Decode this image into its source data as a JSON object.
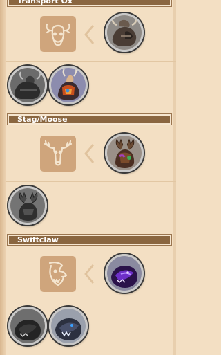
{
  "sections": [
    {
      "title": "Transport Ox",
      "type_icon": "ox-head-icon",
      "evolved_token": "transport-ox-mount-icon",
      "tokens": [
        "transport-ox-dark-token-icon",
        "transport-ox-red-token-icon"
      ]
    },
    {
      "title": "Stag/Moose",
      "type_icon": "moose-head-icon",
      "evolved_token": "stag-moose-mount-icon",
      "tokens": [
        "stag-moose-dark-token-icon"
      ]
    },
    {
      "title": "Swiftclaw",
      "type_icon": "swiftclaw-head-icon",
      "evolved_token": "swiftclaw-purple-mount-icon",
      "tokens": [
        "swiftclaw-dark-token-icon",
        "swiftclaw-blue-token-icon"
      ]
    }
  ],
  "colors": {
    "background": "#f3dfc3",
    "header_bar": "#8a6640",
    "type_icon_bg": "#cfa57c",
    "type_icon_line": "#f4e5cf"
  }
}
